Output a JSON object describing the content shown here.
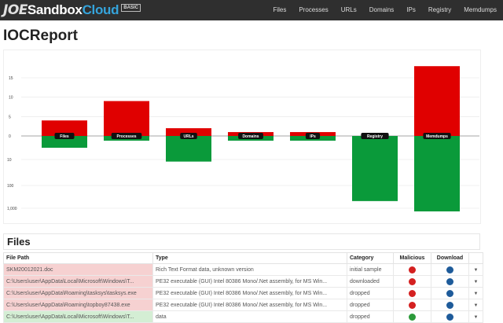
{
  "brand": {
    "joe": "JOE",
    "sandbox": "Sandbox",
    "cloud": "Cloud",
    "edition": "BASIC"
  },
  "nav": [
    "Files",
    "Processes",
    "URLs",
    "Domains",
    "IPs",
    "Registry",
    "Memdumps"
  ],
  "title": "IOCReport",
  "chart_data": {
    "type": "bar",
    "categories": [
      "Files",
      "Processes",
      "URLs",
      "Domains",
      "IPs",
      "Registry",
      "Memdumps"
    ],
    "y_tick_labels_top": [
      "15",
      "10",
      "5",
      "0"
    ],
    "y_tick_labels_bottom": [
      "10",
      "100",
      "1,000"
    ],
    "series": [
      {
        "color": "#e00000",
        "values": [
          4,
          9,
          2,
          1,
          1,
          0,
          18
        ]
      },
      {
        "color": "#0a9a3a",
        "values": [
          5,
          2,
          12,
          2,
          2,
          400,
          1000
        ]
      }
    ],
    "grid": true
  },
  "files": {
    "heading": "Files",
    "columns": [
      "File Path",
      "Type",
      "Category",
      "Malicious",
      "Download"
    ],
    "rows": [
      {
        "path": "SKM20012021.doc",
        "type": "Rich Text Format data, unknown version",
        "category": "initial sample",
        "malicious": true
      },
      {
        "path": "C:\\Users\\user\\AppData\\Local\\Microsoft\\Windows\\T...",
        "type": "PE32 executable (GUI) Intel 80386 Mono/.Net assembly, for MS Win...",
        "category": "downloaded",
        "malicious": true
      },
      {
        "path": "C:\\Users\\user\\AppData\\Roaming\\tasksys\\tasksys.exe",
        "type": "PE32 executable (GUI) Intel 80386 Mono/.Net assembly, for MS Win...",
        "category": "dropped",
        "malicious": true
      },
      {
        "path": "C:\\Users\\user\\AppData\\Roaming\\topboy87438.exe",
        "type": "PE32 executable (GUI) Intel 80386 Mono/.Net assembly, for MS Win...",
        "category": "dropped",
        "malicious": true
      },
      {
        "path": "C:\\Users\\user\\AppData\\Local\\Microsoft\\Windows\\T...",
        "type": "data",
        "category": "dropped",
        "malicious": false
      }
    ]
  }
}
